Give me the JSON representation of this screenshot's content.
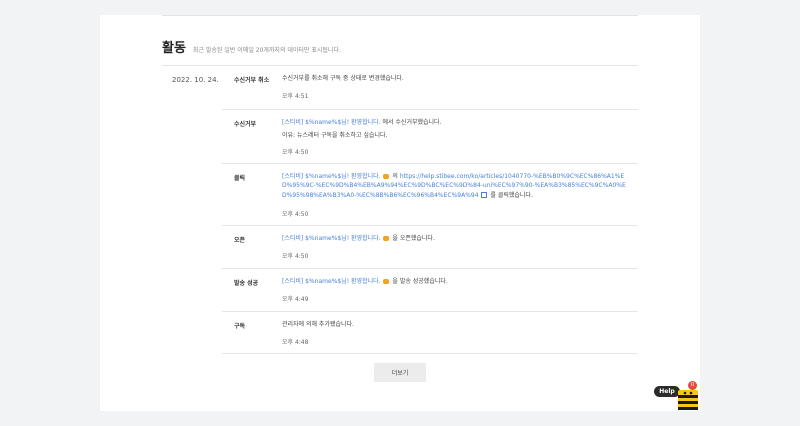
{
  "header": {
    "title": "활동",
    "subtitle": "최근 발송된 일반 이메일 20개까지의 데이터만 표시됩니다."
  },
  "date": "2022. 10. 24.",
  "activities": [
    {
      "label": "수신거부 취소",
      "text": "수신거부를 취소해 구독 중 상태로 변경했습니다.",
      "time": "오후 4:51"
    },
    {
      "label": "수신거부",
      "subject": "[스티비] $%name%$님! 환영합니다.",
      "text": "에서 수신거부했습니다.",
      "reason": "이유: 뉴스레터 구독을 취소하고 싶습니다.",
      "time": "오후 4:50"
    },
    {
      "label": "클릭",
      "subject": "[스티비] $%name%$님! 환영합니다.",
      "mid": "의",
      "url": "https://help.stibee.com/ko/articles/1040770-%EB%B0%9C%EC%86%A1%ED%95%9C-%EC%9D%B4%EB%A9%94%EC%9D%BC%EC%9D%84-uni%EC%97%90-%EA%B3%85%EC%9C%A0%ED%95%98%EA%B3%A0-%EC%8B%B6%EC%96%B4%EC%9A%94",
      "text": "를 클릭했습니다.",
      "time": "오후 4:50"
    },
    {
      "label": "오픈",
      "subject": "[스티비] $%name%$님! 환영합니다.",
      "text": "을 오픈했습니다.",
      "time": "오후 4:50"
    },
    {
      "label": "발송 성공",
      "subject": "[스티비] $%name%$님! 환영합니다.",
      "text": "을 발송 성공했습니다.",
      "time": "오후 4:49"
    },
    {
      "label": "구독",
      "text": "관리자에 의해 추가됐습니다.",
      "time": "오후 4:48"
    }
  ],
  "more_button": "더보기",
  "help": {
    "label": "Help",
    "badge": "0"
  },
  "colors": {
    "link": "#4a80d9",
    "badge": "#e84a3c",
    "bee_yellow": "#f5c518"
  }
}
